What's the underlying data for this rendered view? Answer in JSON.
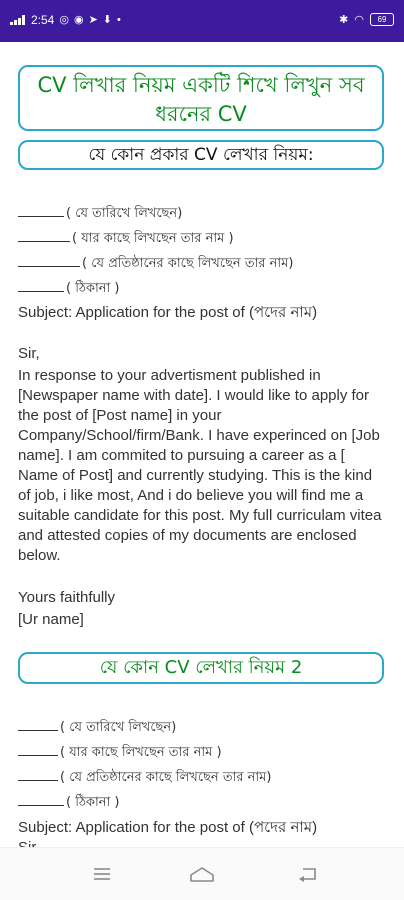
{
  "status": {
    "time": "2:54",
    "battery": "69"
  },
  "titles": {
    "main": "CV লিখার নিয়ম একটি শিখে লিখুন সব ধরনের CV",
    "section1": "যে কোন প্রকার CV লেখার নিয়ম:",
    "section2": "যে কোন CV লেখার নিয়ম 2"
  },
  "letter1": {
    "line1": "( যে তারিখে লিখছেন)",
    "line2": "( যার কাছে লিখছেন তার নাম )",
    "line3": "( যে প্রতিষ্ঠানের কাছে লিখছেন তার নাম)",
    "line4": "( ঠিকানা )",
    "subject": "Subject: Application for the post of (পদের নাম)",
    "salutation": "Sir,",
    "body": "In response to your advertisment published in [Newspaper name with date]. I would like to apply for the post of [Post name] in your Company/School/firm/Bank. I have experinced on [Job name]. I am commited to pursuing a career as a [ Name of Post] and currently studying. This is the kind of job, i like most, And i do believe you will find me a suitable candidate for this post. My full curriculam vitea and attested copies of my documents are enclosed below.",
    "closing": "Yours faithfully",
    "name": "[Ur name]"
  },
  "letter2": {
    "line1": "( যে তারিখে লিখছেন)",
    "line2": "( যার কাছে লিখছেন তার নাম )",
    "line3": "( যে প্রতিষ্ঠানের কাছে লিখছেন তার নাম)",
    "line4": "( ঠিকানা )",
    "subject": "Subject: Application for the post of (পদের নাম)",
    "salutation": "Sir,"
  }
}
